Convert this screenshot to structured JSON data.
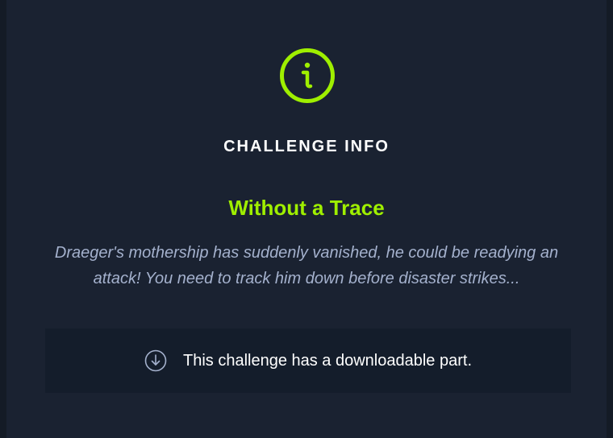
{
  "modal": {
    "heading": "CHALLENGE INFO",
    "title": "Without a Trace",
    "description": "Draeger's mothership has suddenly vanished, he could be readying an attack! You need to track him down before disaster strikes...",
    "download_notice": "This challenge has a downloadable part."
  },
  "icons": {
    "header_icon": "info-icon",
    "download_icon": "download-icon"
  },
  "colors": {
    "accent": "#9fef00",
    "background": "#1a2231",
    "download_box": "#141d2b",
    "description_text": "#a4b1cd"
  }
}
